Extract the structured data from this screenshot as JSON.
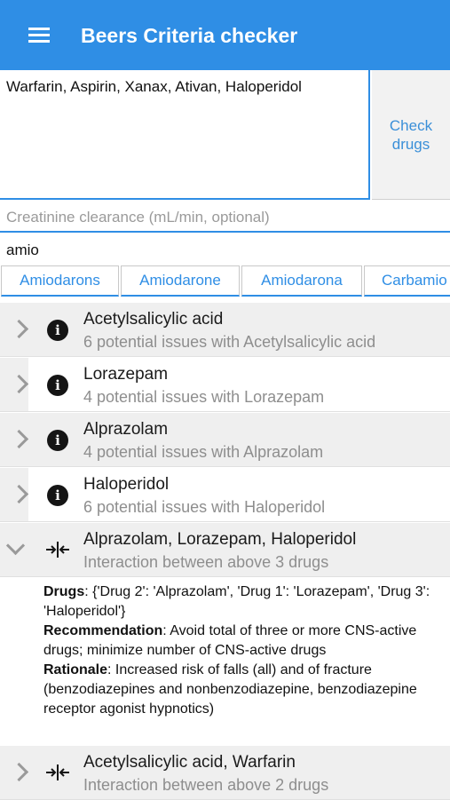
{
  "app_bar": {
    "title": "Beers Criteria checker",
    "menu_icon": "hamburger-menu-icon"
  },
  "drugs_input": {
    "value": "Warfarin, Aspirin, Xanax, Ativan, Haloperidol"
  },
  "check_button": {
    "line1": "Check",
    "line2": "drugs"
  },
  "creatinine_field": {
    "placeholder": "Creatinine clearance (mL/min, optional)"
  },
  "search_field": {
    "value": "amio"
  },
  "suggestions": [
    "Amiodarons",
    "Amiodarone",
    "Amiodarona",
    "Carbamio"
  ],
  "results": [
    {
      "title": "Acetylsalicylic acid",
      "subtitle": "6 potential issues with Acetylsalicylic acid",
      "icon": "info-icon",
      "expanded": false
    },
    {
      "title": "Lorazepam",
      "subtitle": "4 potential issues with Lorazepam",
      "icon": "info-icon",
      "expanded": false
    },
    {
      "title": "Alprazolam",
      "subtitle": "4 potential issues with Alprazolam",
      "icon": "info-icon",
      "expanded": false
    },
    {
      "title": "Haloperidol",
      "subtitle": "6 potential issues with Haloperidol",
      "icon": "info-icon",
      "expanded": false
    },
    {
      "title": "Alprazolam, Lorazepam, Haloperidol",
      "subtitle": "Interaction between above 3 drugs",
      "icon": "merge-icon",
      "expanded": true
    },
    {
      "title": "Acetylsalicylic acid, Warfarin",
      "subtitle": "Interaction between above 2 drugs",
      "icon": "merge-icon",
      "expanded": false
    }
  ],
  "detail": {
    "drugs_label": "Drugs",
    "drugs_value": ": {'Drug 2': 'Alprazolam', 'Drug 1': 'Lorazepam', 'Drug 3': 'Haloperidol'}",
    "recommendation_label": "Recommendation",
    "recommendation_value": ": Avoid total of three or more CNS-active drugs; minimize number of CNS-active drugs",
    "rationale_label": "Rationale",
    "rationale_value": ": Increased risk of falls (all) and of fracture (benzodiazepines and nonbenzodiazepine, benzodiazepine receptor agonist hypnotics)"
  },
  "colors": {
    "accent": "#2f8ee5",
    "row_shade": "#efefef",
    "subtitle": "#8e8e8e"
  }
}
